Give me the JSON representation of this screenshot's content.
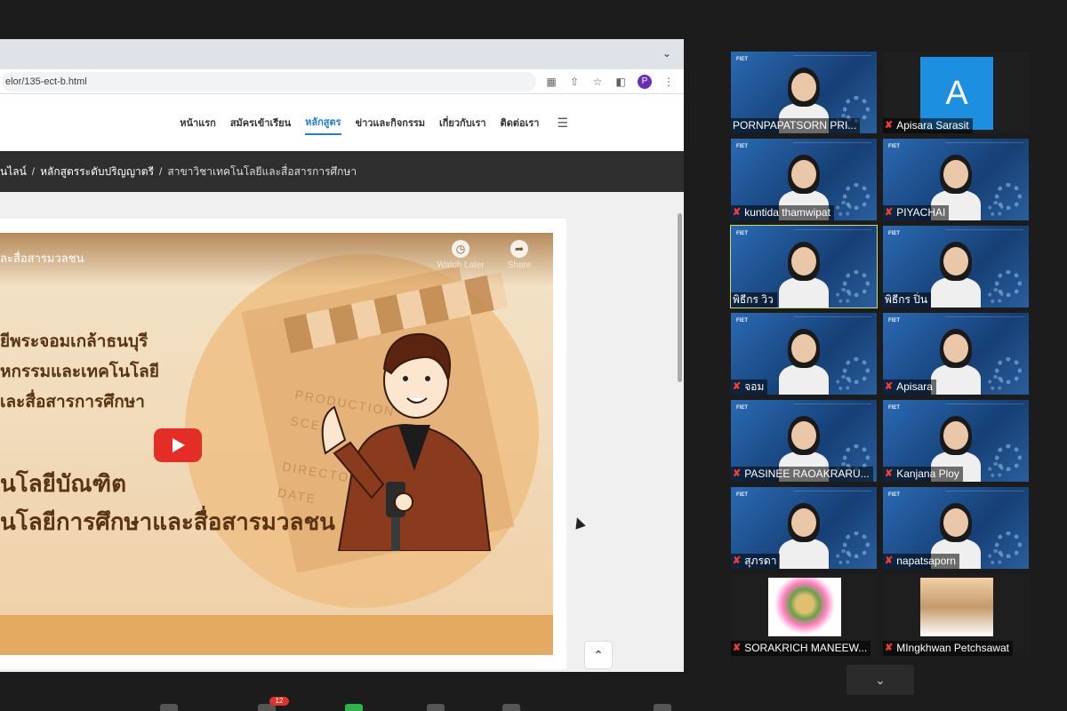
{
  "browser": {
    "url": "elor/135-ect-b.html",
    "profile_initial": "P"
  },
  "site": {
    "nav": [
      {
        "label": "หน้าแรก",
        "active": false
      },
      {
        "label": "สมัครเข้าเรียน",
        "active": false
      },
      {
        "label": "หลักสูตร",
        "active": true
      },
      {
        "label": "ข่าวและกิจกรรม",
        "active": false
      },
      {
        "label": "เกี่ยวกับเรา",
        "active": false
      },
      {
        "label": "ติดต่อเรา",
        "active": false
      }
    ],
    "breadcrumb": [
      "นไลน์",
      "หลักสูตรระดับปริญญาตรี",
      "สาขาวิชาเทคโนโลยีและสื่อสารการศึกษา"
    ]
  },
  "video": {
    "title": "ละสื่อสารมวลชน",
    "watch_later": "Watch Later",
    "share": "Share",
    "lines": [
      "ยีพระจอมเกล้าธนบุรี",
      "หกรรมและเทคโนโลยี",
      "เละสื่อสารการศึกษา",
      "นโลยีบัณฑิต",
      "นโลยีการศึกษาและสื่อสารมวลชน"
    ],
    "clapper_text": [
      "PRODUCTION",
      "SCENE",
      "DIRECTOR",
      "DATE"
    ]
  },
  "participants": [
    {
      "name": "PORNPAPATSORN PRI...",
      "type": "video",
      "muted": false
    },
    {
      "name": "Apisara Sarasit",
      "type": "avatar",
      "initial": "A",
      "muted": true
    },
    {
      "name": "kuntida thamwipat",
      "type": "video",
      "muted": true
    },
    {
      "name": "PIYACHAI",
      "type": "video",
      "muted": true
    },
    {
      "name": "พิธีกร วิว",
      "type": "video",
      "muted": false,
      "active": true
    },
    {
      "name": "พิธีกร ปิ่น",
      "type": "video",
      "muted": false
    },
    {
      "name": "จอม",
      "type": "video",
      "muted": true
    },
    {
      "name": "Apisara",
      "type": "video",
      "muted": true
    },
    {
      "name": "PASINEE RAOAKRARU...",
      "type": "video",
      "muted": true
    },
    {
      "name": "Kanjana Ploy",
      "type": "video",
      "muted": true
    },
    {
      "name": "สุภรดา",
      "type": "video",
      "muted": true
    },
    {
      "name": "napatsaporn",
      "type": "video",
      "muted": true
    },
    {
      "name": "SORAKRICH MANEEW...",
      "type": "photo",
      "muted": true
    },
    {
      "name": "MIngkhwan Petchsawat",
      "type": "photo",
      "muted": true
    }
  ],
  "toolbar": {
    "chat_badge": "12"
  },
  "colors": {
    "accent": "#1e7fd3",
    "speaker_outline": "#c8e06a",
    "youtube_red": "#e52d27",
    "mute_red": "#ff3b30"
  }
}
